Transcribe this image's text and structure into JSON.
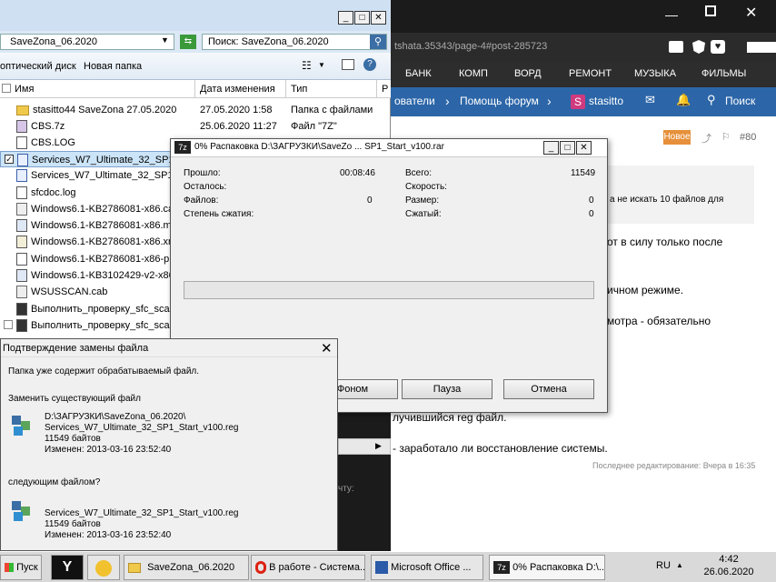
{
  "browser": {
    "url_fragment": "tshata.35343/page-4#post-285723",
    "menu": [
      "БАНК",
      "КОМП",
      "ВОРД",
      "РЕМОНТ",
      "МУЗЫКА",
      "ФИЛЬМЫ"
    ],
    "nav": {
      "users": "ователи",
      "help": "Помощь форум",
      "user": "stasitto",
      "user_initial": "S",
      "search": "Поиск"
    },
    "post": {
      "badge": "Новое",
      "number": "#80",
      "line1": "а не искать 10 файлов для",
      "line2": "от в силу только после",
      "line3": "ичном режиме.",
      "line4": "мотра - обязательно",
      "line5": "лучившийся reg файл.",
      "line6": "- заработало ли восстановление системы.",
      "edited": "Последнее редактирование: Вчера в 16:35",
      "reply_hint": "чту:"
    }
  },
  "explorer": {
    "address": "SaveZona_06.2020",
    "search_placeholder": "Поиск: SaveZona_06.2020",
    "toolbar": {
      "burn": "оптический диск",
      "new_folder": "Новая папка"
    },
    "columns": {
      "name": "Имя",
      "date": "Дата изменения",
      "type": "Тип",
      "size_abbr": "Р"
    },
    "files": [
      {
        "name": "stasitto44 SaveZona 27.05.2020",
        "date": "27.05.2020 1:58",
        "type": "Папка с файлами",
        "icon": "folder"
      },
      {
        "name": "CBS.7z",
        "date": "25.06.2020 11:27",
        "type": "Файл \"7Z\"",
        "icon": "archive"
      },
      {
        "name": "CBS.LOG",
        "date": "",
        "type": "",
        "icon": "text"
      },
      {
        "name": "Services_W7_Ultimate_32_SP1_Start",
        "date": "",
        "type": "",
        "icon": "reg"
      },
      {
        "name": "Services_W7_Ultimate_32_SP1_Start",
        "date": "",
        "type": "",
        "icon": "reg"
      },
      {
        "name": "sfcdoc.log",
        "date": "",
        "type": "",
        "icon": "text"
      },
      {
        "name": "Windows6.1-KB2786081-x86.cab",
        "date": "",
        "type": "",
        "icon": "cab"
      },
      {
        "name": "Windows6.1-KB2786081-x86.msu",
        "date": "",
        "type": "",
        "icon": "msu"
      },
      {
        "name": "Windows6.1-KB2786081-x86.xml",
        "date": "",
        "type": "",
        "icon": "xml"
      },
      {
        "name": "Windows6.1-KB2786081-x86-pkgPr",
        "date": "",
        "type": "",
        "icon": "text"
      },
      {
        "name": "Windows6.1-KB3102429-v2-x86.ms",
        "date": "",
        "type": "",
        "icon": "msu"
      },
      {
        "name": "WSUSSCAN.cab",
        "date": "",
        "type": "",
        "icon": "cab"
      },
      {
        "name": "Выполнить_проверку_sfc_scanno",
        "date": "",
        "type": "",
        "icon": "cmd"
      },
      {
        "name": "Выполнить_проверку_sfc_scanno",
        "date": "",
        "type": "",
        "icon": "cmd"
      }
    ]
  },
  "extract": {
    "title": "0% Распаковка D:\\ЗАГРУЗКИ\\SaveZo ... SP1_Start_v100.rar",
    "labels": {
      "elapsed": "Прошло:",
      "remaining": "Осталось:",
      "files": "Файлов:",
      "ratio": "Степень сжатия:",
      "total": "Всего:",
      "speed": "Скорость:",
      "size": "Размер:",
      "packed": "Сжатый:"
    },
    "values": {
      "elapsed": "00:08:46",
      "files": "0",
      "total": "11549",
      "size": "0",
      "packed": "0"
    },
    "progress": 0,
    "buttons": {
      "background": "Фоном",
      "pause": "Пауза",
      "cancel": "Отмена"
    }
  },
  "confirm": {
    "title": "Подтверждение замены файла",
    "message": "Папка уже содержит обрабатываемый файл.",
    "replace_q": "Заменить существующий файл",
    "existing": {
      "path": "D:\\ЗАГРУЗКИ\\SaveZona_06.2020\\",
      "name": "Services_W7_Ultimate_32_SP1_Start_v100.reg",
      "size": "11549 байтов",
      "modified": "Изменен: 2013-03-16 23:52:40"
    },
    "with_q": "следующим файлом?",
    "incoming": {
      "name": "Services_W7_Ultimate_32_SP1_Start_v100.reg",
      "size": "11549 байтов",
      "modified": "Изменен: 2013-03-16 23:52:40"
    }
  },
  "taskbar": {
    "start": "Пуск",
    "tasks": [
      "SaveZona_06.2020",
      "В работе - Система...",
      "Microsoft Office ...",
      "0% Распаковка D:\\..."
    ],
    "lang": "RU",
    "time": "4:42",
    "date": "26.06.2020"
  }
}
